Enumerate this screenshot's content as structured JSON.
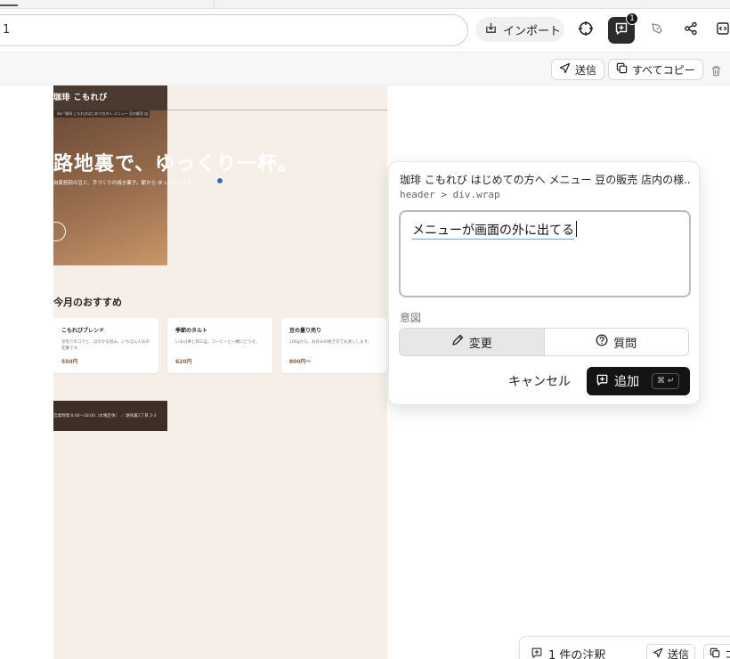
{
  "toolbar": {
    "url_fragment": "1",
    "import_label": "インポート",
    "annotation_count": "1"
  },
  "actionbar": {
    "send_label": "送信",
    "copy_all_label": "すべてコピー"
  },
  "site": {
    "brand": "珈琲 こもれび",
    "crumb": "div \"珈琲 こもれびはじめての方へ メニュー 豆の販売 店...",
    "hero_title": "路地裏で、ゆっくり一杯。",
    "hero_sub": "自家焙煎の豆と、手づくりの焼き菓子。駅から ゆっくりどうぞ。",
    "section_title": "今月のおすすめ",
    "cards": [
      {
        "name": "こもれびブレンド",
        "desc": "深煎りのコクと、ほのかな甘み。いちばん人気の定番です。",
        "price": "550円"
      },
      {
        "name": "季節のタルト",
        "desc": "いまは栗と和三盆。コーヒーと一緒にどうぞ。",
        "price": "620円"
      },
      {
        "name": "豆の量り売り",
        "desc": "100gから。お好みの挽き方でお渡しします。",
        "price": "800円〜"
      }
    ],
    "footer": "営業時間 8:00〜18:00（水曜定休） ／ 路地裏1丁目 2-3"
  },
  "popup": {
    "title": "珈琲 こもれび はじめての方へ メニュー 豆の販売 店内の様...",
    "path": "header > div.wrap",
    "text_value": "メニューが画面の外に出てる",
    "intent_label": "意図",
    "intent_change": "変更",
    "intent_question": "質問",
    "cancel_label": "キャンセル",
    "add_label": "追加",
    "shortcut": "⌘ ↵"
  },
  "bottombar": {
    "count_label": "1 件の注釈",
    "send_label": "送信",
    "copy_label": "コ"
  },
  "colors": {
    "accent_dark": "#141414",
    "site_bg": "#f6efe8",
    "site_header": "#4a3a30",
    "price": "#8a5a3a",
    "focus_underline": "#5aa9e6"
  }
}
